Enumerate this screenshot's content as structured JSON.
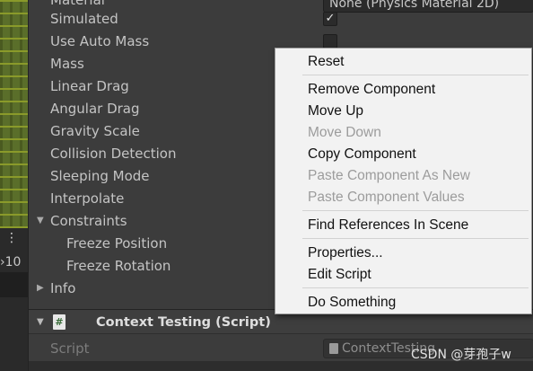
{
  "left_strip": {
    "counter": "›10"
  },
  "inspector": {
    "top_field": "None (Physics Material 2D)",
    "rows": [
      {
        "label": "Material"
      },
      {
        "label": "Simulated",
        "checked": true
      },
      {
        "label": "Use Auto Mass",
        "checked": false
      },
      {
        "label": "Mass"
      },
      {
        "label": "Linear Drag"
      },
      {
        "label": "Angular Drag"
      },
      {
        "label": "Gravity Scale"
      },
      {
        "label": "Collision Detection"
      },
      {
        "label": "Sleeping Mode"
      },
      {
        "label": "Interpolate"
      },
      {
        "label": "Constraints",
        "expanded": true
      },
      {
        "label": "Freeze Position"
      },
      {
        "label": "Freeze Rotation"
      },
      {
        "label": "Info",
        "expanded": false
      }
    ],
    "component": {
      "title": "Context Testing (Script)",
      "icon": "#",
      "script_label": "Script",
      "script_value": "ContextTesting"
    }
  },
  "context_menu": {
    "items": [
      {
        "label": "Reset",
        "enabled": true
      },
      {
        "label": "Remove Component",
        "enabled": true
      },
      {
        "label": "Move Up",
        "enabled": true
      },
      {
        "label": "Move Down",
        "enabled": false
      },
      {
        "label": "Copy Component",
        "enabled": true
      },
      {
        "label": "Paste Component As New",
        "enabled": false
      },
      {
        "label": "Paste Component Values",
        "enabled": false
      },
      {
        "label": "Find References In Scene",
        "enabled": true
      },
      {
        "label": "Properties...",
        "enabled": true
      },
      {
        "label": "Edit Script",
        "enabled": true
      },
      {
        "label": "Do Something",
        "enabled": true
      }
    ]
  },
  "watermark": "CSDN @芽孢子w",
  "colors": {
    "inspector_bg": "#3c3c3c",
    "menu_bg": "#f2f2f2",
    "disabled_text": "#9c9c9c"
  }
}
